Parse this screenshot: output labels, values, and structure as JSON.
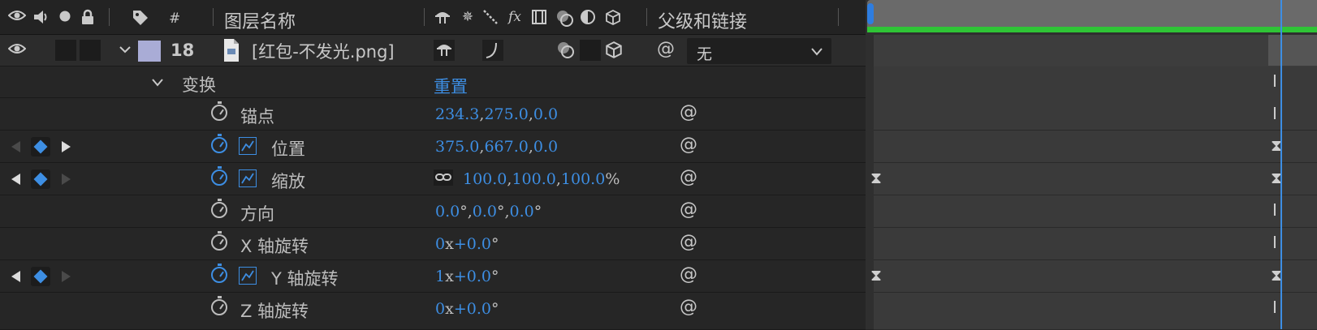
{
  "header": {
    "hash": "#",
    "layer_name_title": "图层名称",
    "fx_label": "fx",
    "parent_title": "父级和链接"
  },
  "layer": {
    "number": "18",
    "name": "[红包-不发光.png]",
    "parent_value": "无",
    "label_color": "#a9acd6"
  },
  "transform": {
    "label": "变换",
    "reset": "重置"
  },
  "properties": [
    {
      "label": "锚点",
      "values": [
        "234.3",
        "275.0",
        "0.0"
      ]
    },
    {
      "label": "位置",
      "values": [
        "375.0",
        "667.0",
        "0.0"
      ]
    },
    {
      "label": "缩放",
      "values": [
        "100.0",
        "100.0",
        "100.0"
      ],
      "unit": "%"
    },
    {
      "label": "方向",
      "values": [
        "0.0",
        "0.0",
        "0.0"
      ],
      "unit": "°"
    },
    {
      "label": "X 轴旋转",
      "turns": "0",
      "angle": "+0.0"
    },
    {
      "label": "Y 轴旋转",
      "turns": "1",
      "angle": "+0.0"
    },
    {
      "label": "Z 轴旋转",
      "turns": "0",
      "angle": "+0.0"
    }
  ],
  "colors": {
    "accent": "#3d8ee3",
    "timeline_green": "#2fc436",
    "bg": "#232323"
  }
}
